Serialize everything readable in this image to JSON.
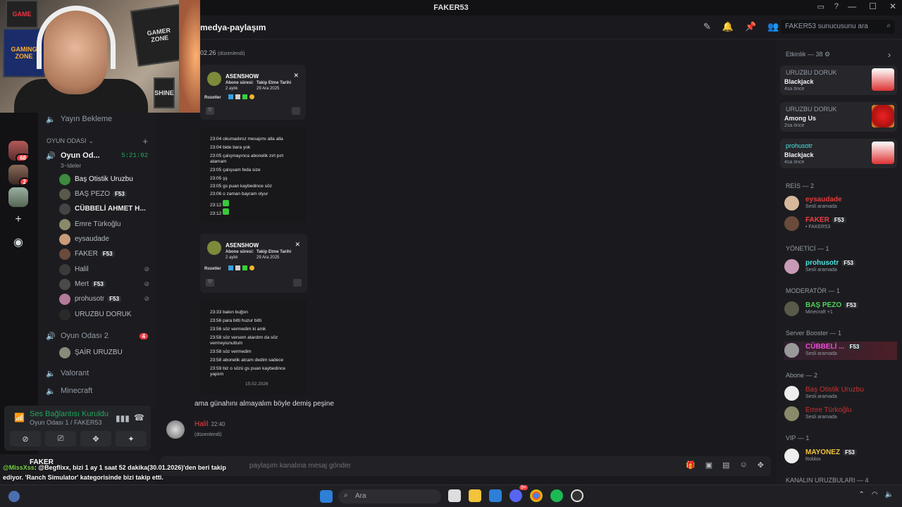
{
  "window": {
    "title": "FAKER53"
  },
  "header": {
    "channel": "medya-paylaşım",
    "search_placeholder": "FAKER53 sunucusunu ara"
  },
  "rail": {
    "badges": [
      "68",
      "2"
    ]
  },
  "channels": {
    "stream_wait": "Yayın Bekleme",
    "category": "OYUN ODASI",
    "room1": {
      "name": "Oyun Od...",
      "timer": "5:21:02",
      "topic": "3~Ideler"
    },
    "room1_users": [
      {
        "name": "Baş Otistik Uruzbu",
        "tag": ""
      },
      {
        "name": "BAŞ PEZO",
        "tag": "F53"
      },
      {
        "name": "CÜBBELİ AHMET H...",
        "tag": ""
      },
      {
        "name": "Emre Türkoğlu",
        "tag": ""
      },
      {
        "name": "eysaudade",
        "tag": ""
      },
      {
        "name": "FAKER",
        "tag": "F53"
      },
      {
        "name": "Halil",
        "tag": ""
      },
      {
        "name": "Mert",
        "tag": "F53"
      },
      {
        "name": "prohusotr",
        "tag": "F53"
      },
      {
        "name": "URUZBU DORUK",
        "tag": ""
      }
    ],
    "room2": {
      "name": "Oyun Odası 2",
      "badge": "4"
    },
    "room2_users": [
      {
        "name": "ŞAİR URUZBU"
      }
    ],
    "valorant": "Valorant",
    "minecraft": "Minecraft"
  },
  "voice": {
    "status": "Ses Bağlantısı Kuruldu",
    "sub": "Oyun Odası 1 / FAKER53"
  },
  "userbar": {
    "name": "FAKER"
  },
  "chat": {
    "date_label": "02.26",
    "edited_label": "(düzenlendi)",
    "card1": {
      "name": "ASENSHOW",
      "sub_label": "Abone süresi:",
      "sub_value": "2 aylık",
      "follow_label": "Takip Etme Tarihi",
      "follow_value": "29 Ara 2025",
      "badges": "Rozetler"
    },
    "log1": [
      {
        "t": "23:04",
        "m": "okumadınız mesajımı alla alla"
      },
      {
        "t": "23:04",
        "m": "bide bara yok"
      },
      {
        "t": "23:05",
        "m": "çalışmayınca abonelik zırt pırt"
      },
      {
        "t": "",
        "m": "atamam"
      },
      {
        "t": "23:05",
        "m": "çalışsam feda size"
      },
      {
        "t": "23:05",
        "m": "şş"
      },
      {
        "t": "23:05",
        "m": "gs puan kaybedince söz"
      },
      {
        "t": "23:06",
        "m": "o zaman bayram olyur"
      },
      {
        "t": "23:12",
        "m": ""
      },
      {
        "t": "23:12",
        "m": ""
      }
    ],
    "card2": {
      "name": "ASENSHOW",
      "sub_label": "Abone süresi:",
      "sub_value": "2 aylık",
      "follow_label": "Takip Etme Tarihi",
      "follow_value": "29 Ara 2025",
      "badges": "Rozetler"
    },
    "log2": [
      {
        "t": "23:33",
        "m": "bakın buğon"
      },
      {
        "t": "23:56",
        "m": "para bitti huzur bitti"
      },
      {
        "t": "23:56",
        "m": "söz vermedim ki amk"
      },
      {
        "t": "23:58",
        "m": "söz versem atardım da söz"
      },
      {
        "t": "",
        "m": "vermeyiunuttum"
      },
      {
        "t": "23:58",
        "m": "söz vermedim"
      },
      {
        "t": "23:58",
        "m": "abonelik atcam dedim sadece"
      },
      {
        "t": "23:59",
        "m": "biz o sözü gs puan kaybedince"
      },
      {
        "t": "",
        "m": "yapiım"
      },
      {
        "t": "",
        "m": "15.02.2026"
      }
    ],
    "message": "ama günahını almayalım böyle demiş peşine",
    "author": "Halil",
    "time": "22:40",
    "composer_placeholder": "paylaşım kanalına mesaj gönder"
  },
  "members": {
    "events_header": "Etkinlik — 38",
    "events": [
      {
        "who": "URUZBU DORUK",
        "game": "Blackjack",
        "ago": "4sa önce"
      },
      {
        "who": "URUZBU DORUK",
        "game": "Among Us",
        "ago": "2sa önce"
      },
      {
        "who": "prohusotr",
        "game": "Blackjack",
        "ago": "4sa önce"
      }
    ],
    "groups": [
      {
        "label": "REİS — 2"
      },
      {
        "label": "YÖNETİCİ — 1"
      },
      {
        "label": "MODERATÖR — 1"
      },
      {
        "label": "Server Booster — 1"
      },
      {
        "label": "Abone — 2"
      },
      {
        "label": "VIP — 1"
      },
      {
        "label": "KANALIN URUZBULARI — 4"
      }
    ],
    "list": [
      {
        "name": "eysaudade",
        "sub": "Sesli aramada",
        "color": "#e13b3b"
      },
      {
        "name": "FAKER",
        "sub": "• FAKER53",
        "color": "#f23f43",
        "tag": "F53"
      },
      {
        "name": "prohusotr",
        "sub": "Sesli aramada",
        "color": "#4ee2e0",
        "tag": "F53"
      },
      {
        "name": "BAŞ PEZO",
        "sub": "Minecraft +1",
        "color": "#4fd35a",
        "tag": "F53"
      },
      {
        "name": "CÜBBELİ ...",
        "sub": "Sesli aramada",
        "color": "#f04fd8",
        "tag": "F53"
      },
      {
        "name": "Baş Otistik Uruzbu",
        "sub": "Sesli aramada",
        "color": "#c93232"
      },
      {
        "name": "Emre Türkoğlu",
        "sub": "Sesli aramada",
        "color": "#c93232"
      },
      {
        "name": "MAYONEZ",
        "sub": "Roblox",
        "color": "#f3c33c",
        "tag": "F53"
      }
    ]
  },
  "overlay": {
    "mention": "@MissXss",
    "text1": ": @Begflixx, bizi 1 ay 1 saat 52 dakika(30.01.2026)'den beri takip",
    "text2": "ediyor. 'Ranch Simulator' kategorisinde bizi takip etti."
  },
  "taskbar": {
    "search": "Ara",
    "discord_badge": "9+"
  }
}
